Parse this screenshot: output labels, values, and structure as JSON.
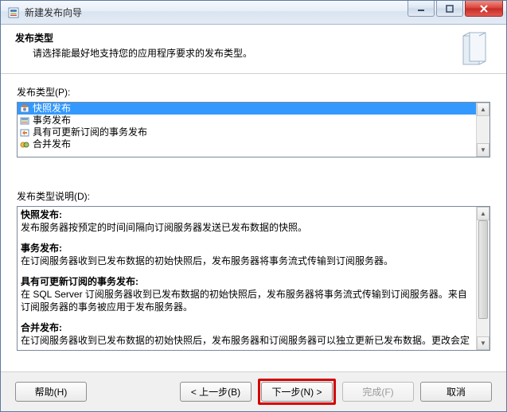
{
  "window": {
    "title": "新建发布向导"
  },
  "header": {
    "title": "发布类型",
    "subtitle": "请选择能最好地支持您的应用程序要求的发布类型。"
  },
  "labels": {
    "publishType": "发布类型(P):",
    "description": "发布类型说明(D):"
  },
  "types": {
    "items": [
      {
        "label": "快照发布",
        "icon": "snapshot-icon"
      },
      {
        "label": "事务发布",
        "icon": "txn-icon"
      },
      {
        "label": "具有可更新订阅的事务发布",
        "icon": "txn-upd-icon"
      },
      {
        "label": "合并发布",
        "icon": "merge-icon"
      }
    ],
    "selectedIndex": 0
  },
  "description": {
    "blocks": [
      {
        "title": "快照发布:",
        "body": "发布服务器按预定的时间间隔向订阅服务器发送已发布数据的快照。"
      },
      {
        "title": "事务发布:",
        "body": "在订阅服务器收到已发布数据的初始快照后，发布服务器将事务流式传输到订阅服务器。"
      },
      {
        "title": "具有可更新订阅的事务发布:",
        "body": "在 SQL Server 订阅服务器收到已发布数据的初始快照后，发布服务器将事务流式传输到订阅服务器。来自订阅服务器的事务被应用于发布服务器。"
      },
      {
        "title": "合并发布:",
        "body": "在订阅服务器收到已发布数据的初始快照后，发布服务器和订阅服务器可以独立更新已发布数据。更改会定期合并。"
      }
    ]
  },
  "buttons": {
    "help": "帮助(H)",
    "back": "< 上一步(B)",
    "next": "下一步(N) >",
    "finish": "完成(F)",
    "cancel": "取消"
  }
}
